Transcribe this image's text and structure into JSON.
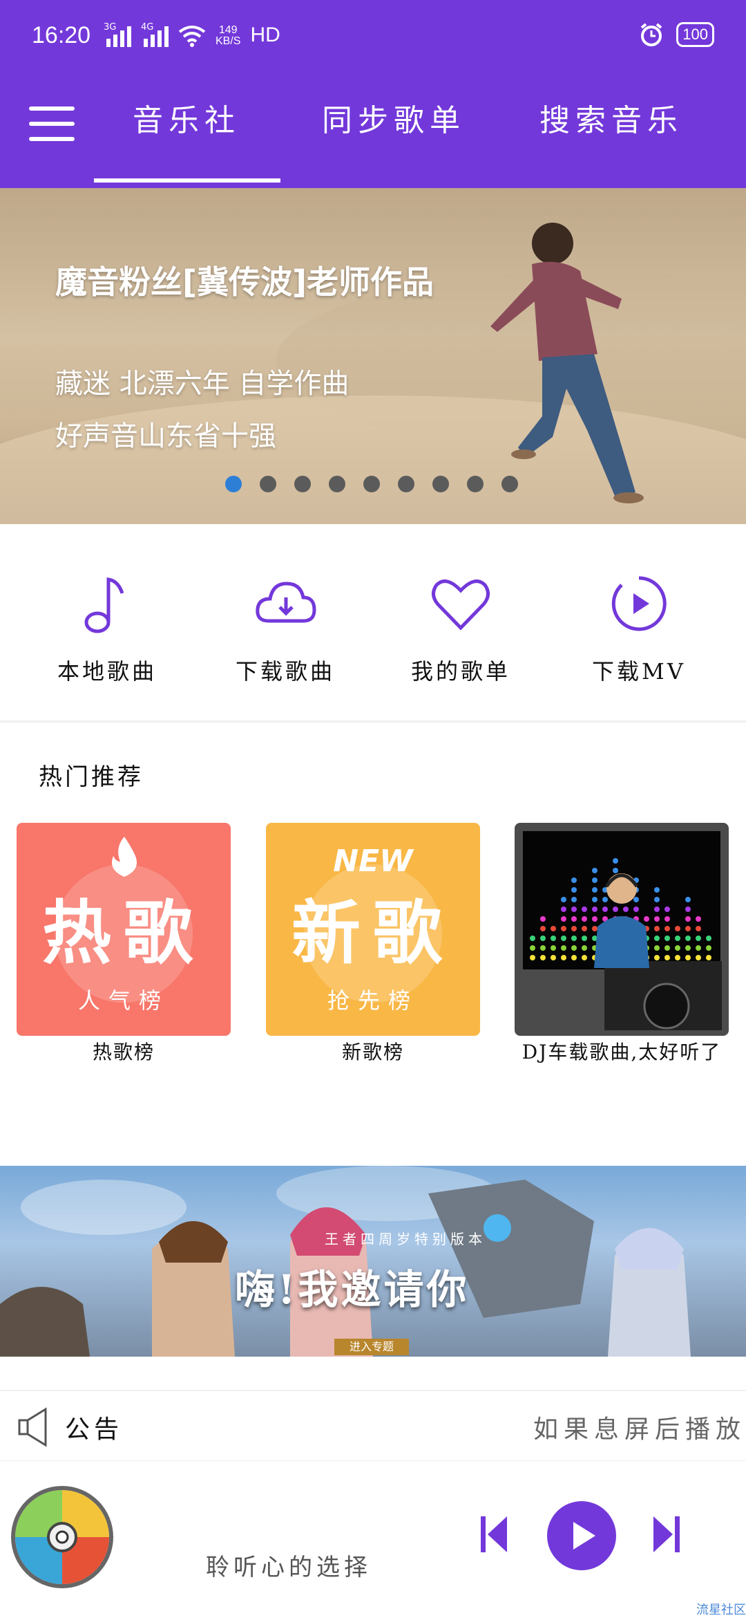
{
  "status_bar": {
    "time": "16:20",
    "net1": "3G",
    "net2": "4G",
    "speed_value": "149",
    "speed_unit": "KB/S",
    "hd": "HD",
    "battery": "100"
  },
  "header": {
    "tabs": [
      {
        "label": "音乐社"
      },
      {
        "label": "同步歌单"
      },
      {
        "label": "搜索音乐"
      }
    ],
    "accent": "#7338DA"
  },
  "banner": {
    "title": "魔音粉丝[冀传波]老师作品",
    "line1": "藏迷 北漂六年 自学作曲",
    "line2": "好声音山东省十强",
    "page_count": 9,
    "active_index": 0
  },
  "actions": [
    {
      "label": "本地歌曲",
      "icon": "music-note-icon"
    },
    {
      "label": "下载歌曲",
      "icon": "cloud-download-icon"
    },
    {
      "label": "我的歌单",
      "icon": "heart-icon"
    },
    {
      "label": "下载MV",
      "icon": "play-circle-icon"
    }
  ],
  "hot": {
    "title": "热门推荐",
    "cards": [
      {
        "big": "热歌",
        "sub": "人气榜",
        "caption": "热歌榜"
      },
      {
        "big": "新歌",
        "sub": "抢先榜",
        "badge": "NEW",
        "caption": "新歌榜"
      },
      {
        "caption": "DJ车载歌曲,太好听了"
      }
    ]
  },
  "ad": {
    "subtitle": "王者四周岁特别版本",
    "title": "嗨!我邀请你",
    "button": "进入专题"
  },
  "notice": {
    "label": "公告",
    "text": "如果息屏后播放音"
  },
  "player": {
    "text": "聆听心的选择"
  },
  "watermark": "流星社区"
}
